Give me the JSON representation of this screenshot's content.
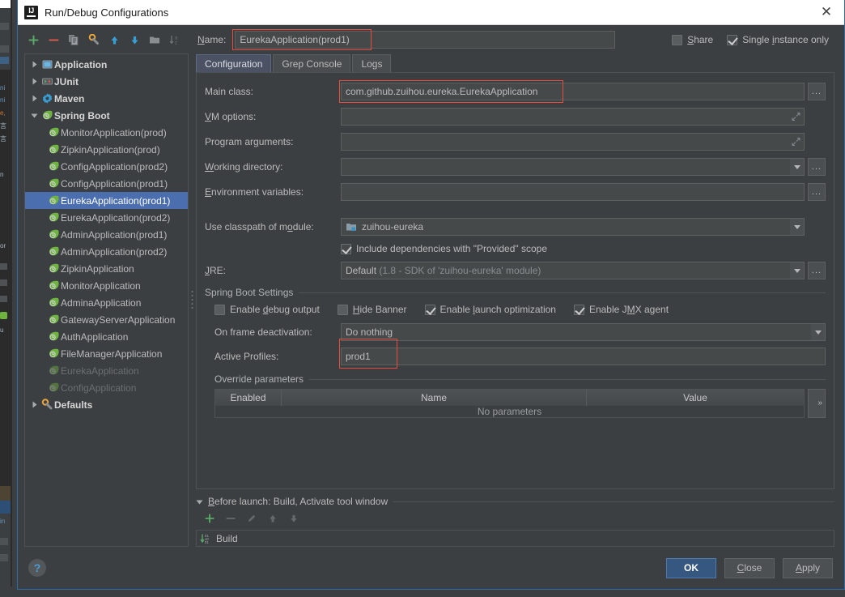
{
  "window": {
    "title": "Run/Debug Configurations",
    "app_icon": "intellij-idea-icon",
    "close_label": "✕"
  },
  "toolbar": {
    "items": [
      {
        "name": "add-configuration-button",
        "icon": "plus-icon",
        "tooltip": "Add New Configuration"
      },
      {
        "name": "remove-configuration-button",
        "icon": "minus-icon",
        "tooltip": "Remove Configuration"
      },
      {
        "name": "copy-configuration-button",
        "icon": "copy-icon",
        "tooltip": "Copy Configuration"
      },
      {
        "name": "edit-defaults-button",
        "icon": "wrench-gear-icon",
        "tooltip": "Edit defaults"
      },
      {
        "name": "move-up-button",
        "icon": "arrow-up-icon",
        "tooltip": "Move Up"
      },
      {
        "name": "move-down-button",
        "icon": "arrow-down-icon",
        "tooltip": "Move Down"
      },
      {
        "name": "create-folder-button",
        "icon": "folder-icon",
        "tooltip": "Create New Folder"
      },
      {
        "name": "sort-configurations-button",
        "icon": "sort-alpha-icon",
        "tooltip": "Sort Configurations"
      }
    ]
  },
  "name_field": {
    "label": "Name:",
    "label_mnemonic": "N",
    "value": "EurekaApplication(prod1)",
    "highlighted": true
  },
  "header_checkboxes": [
    {
      "name": "share-checkbox",
      "label": "Share",
      "mnemonic": "S",
      "checked": false
    },
    {
      "name": "single-instance-checkbox",
      "label": "Single instance only",
      "mnemonic": "i",
      "checked": true
    }
  ],
  "tree": {
    "nodes": [
      {
        "label": "Application",
        "type": "group",
        "expanded": false,
        "icon": "application-icon",
        "selected": false,
        "disabled": false
      },
      {
        "label": "JUnit",
        "type": "group",
        "expanded": false,
        "icon": "junit-icon",
        "selected": false,
        "disabled": false
      },
      {
        "label": "Maven",
        "type": "group",
        "expanded": false,
        "icon": "maven-icon",
        "selected": false,
        "disabled": false
      },
      {
        "label": "Spring Boot",
        "type": "group",
        "expanded": true,
        "icon": "spring-boot-icon",
        "selected": false,
        "disabled": false
      },
      {
        "label": "MonitorApplication(prod)",
        "type": "leaf",
        "icon": "spring-boot-icon",
        "selected": false,
        "disabled": false
      },
      {
        "label": "ZipkinApplication(prod)",
        "type": "leaf",
        "icon": "spring-boot-icon",
        "selected": false,
        "disabled": false
      },
      {
        "label": "ConfigApplication(prod2)",
        "type": "leaf",
        "icon": "spring-boot-icon",
        "selected": false,
        "disabled": false
      },
      {
        "label": "ConfigApplication(prod1)",
        "type": "leaf",
        "icon": "spring-boot-icon",
        "selected": false,
        "disabled": false
      },
      {
        "label": "EurekaApplication(prod1)",
        "type": "leaf",
        "icon": "spring-boot-icon",
        "selected": true,
        "disabled": false
      },
      {
        "label": "EurekaApplication(prod2)",
        "type": "leaf",
        "icon": "spring-boot-icon",
        "selected": false,
        "disabled": false
      },
      {
        "label": "AdminApplication(prod1)",
        "type": "leaf",
        "icon": "spring-boot-icon",
        "selected": false,
        "disabled": false
      },
      {
        "label": "AdminApplication(prod2)",
        "type": "leaf",
        "icon": "spring-boot-icon",
        "selected": false,
        "disabled": false
      },
      {
        "label": "ZipkinApplication",
        "type": "leaf",
        "icon": "spring-boot-icon",
        "selected": false,
        "disabled": false
      },
      {
        "label": "MonitorApplication",
        "type": "leaf",
        "icon": "spring-boot-icon",
        "selected": false,
        "disabled": false
      },
      {
        "label": "AdminaApplication",
        "type": "leaf",
        "icon": "spring-boot-icon",
        "selected": false,
        "disabled": false
      },
      {
        "label": "GatewayServerApplication",
        "type": "leaf",
        "icon": "spring-boot-icon",
        "selected": false,
        "disabled": false
      },
      {
        "label": "AuthApplication",
        "type": "leaf",
        "icon": "spring-boot-icon",
        "selected": false,
        "disabled": false
      },
      {
        "label": "FileManagerApplication",
        "type": "leaf",
        "icon": "spring-boot-icon",
        "selected": false,
        "disabled": false
      },
      {
        "label": "EurekaApplication",
        "type": "leaf",
        "icon": "spring-boot-icon",
        "selected": false,
        "disabled": true
      },
      {
        "label": "ConfigApplication",
        "type": "leaf",
        "icon": "spring-boot-icon",
        "selected": false,
        "disabled": true
      },
      {
        "label": "Defaults",
        "type": "group",
        "expanded": false,
        "icon": "defaults-wrench-icon",
        "selected": false,
        "disabled": false
      }
    ]
  },
  "tabs": [
    {
      "name": "tab-configuration",
      "label": "Configuration",
      "active": true
    },
    {
      "name": "tab-grep-console",
      "label": "Grep Console",
      "active": false
    },
    {
      "name": "tab-logs",
      "label": "Logs",
      "active": false
    }
  ],
  "config": {
    "main_class": {
      "label": "Main class:",
      "value": "com.github.zuihou.eureka.EurekaApplication",
      "highlighted": true,
      "browse_label": "..."
    },
    "vm_options": {
      "label": "VM options:",
      "mnemonic": "V",
      "value": "",
      "expand_icon": "expand-diagonal-icon"
    },
    "program_arguments": {
      "label": "Program arguments:",
      "mnemonic": "g",
      "value": "",
      "expand_icon": "expand-diagonal-icon"
    },
    "working_directory": {
      "label": "Working directory:",
      "mnemonic": "W",
      "value": "",
      "browse_label": "..."
    },
    "environment_variables": {
      "label": "Environment variables:",
      "mnemonic": "E",
      "value": "",
      "browse_label": "..."
    },
    "use_classpath_of_module": {
      "label": "Use classpath of module:",
      "mnemonic": "o",
      "value": "zuihou-eureka",
      "icon": "module-icon"
    },
    "include_provided": {
      "label": "Include dependencies with \"Provided\" scope",
      "checked": true
    },
    "jre": {
      "label": "JRE:",
      "mnemonic": "J",
      "value": "Default",
      "hint": "(1.8 - SDK of 'zuihou-eureka' module)",
      "browse_label": "..."
    }
  },
  "spring_boot_settings": {
    "title": "Spring Boot Settings",
    "checkboxes": [
      {
        "name": "enable-debug-output-checkbox",
        "label": "Enable debug output",
        "mnemonic": "d",
        "checked": false
      },
      {
        "name": "hide-banner-checkbox",
        "label": "Hide Banner",
        "mnemonic": "H",
        "checked": false
      },
      {
        "name": "enable-launch-optimization-checkbox",
        "label": "Enable launch optimization",
        "mnemonic": "l",
        "checked": true
      },
      {
        "name": "enable-jmx-agent-checkbox",
        "label": "Enable JMX agent",
        "mnemonic": "M",
        "checked": true
      }
    ],
    "on_frame_deactivation": {
      "label": "On frame deactivation:",
      "value": "Do nothing"
    },
    "active_profiles": {
      "label": "Active Profiles:",
      "value": "prod1",
      "highlighted": true
    },
    "override_parameters": {
      "title": "Override parameters",
      "columns": [
        "Enabled",
        "Name",
        "Value"
      ],
      "rows": [],
      "empty_text": "No parameters",
      "expand_label": "»"
    }
  },
  "before_launch": {
    "title": "Before launch: Build, Activate tool window",
    "mnemonic": "B",
    "expanded": true,
    "toolbar": [
      {
        "name": "add-before-launch-task-button",
        "icon": "plus-icon",
        "enabled": true
      },
      {
        "name": "remove-before-launch-task-button",
        "icon": "minus-icon",
        "enabled": false
      },
      {
        "name": "edit-before-launch-task-button",
        "icon": "pencil-icon",
        "enabled": false
      },
      {
        "name": "move-task-up-button",
        "icon": "arrow-up-icon",
        "enabled": false
      },
      {
        "name": "move-task-down-button",
        "icon": "arrow-down-icon",
        "enabled": false
      }
    ],
    "tasks": [
      {
        "label": "Build",
        "icon": "build-icon"
      }
    ]
  },
  "footer": {
    "help_label": "?",
    "buttons": [
      {
        "name": "ok-button",
        "label": "OK",
        "primary": true
      },
      {
        "name": "close-button",
        "label": "Close",
        "mnemonic": "C",
        "primary": false
      },
      {
        "name": "apply-button",
        "label": "Apply",
        "mnemonic": "A",
        "primary": false
      }
    ]
  },
  "colors": {
    "dialog_bg": "#3c3f41",
    "field_bg": "#45494a",
    "selection_blue": "#4b6eaf",
    "accent_border": "#2d6ca8",
    "highlight_red": "#e74c3c",
    "primary_button": "#365880",
    "text": "#bbbbbb",
    "spring_green": "#6eb33f"
  }
}
